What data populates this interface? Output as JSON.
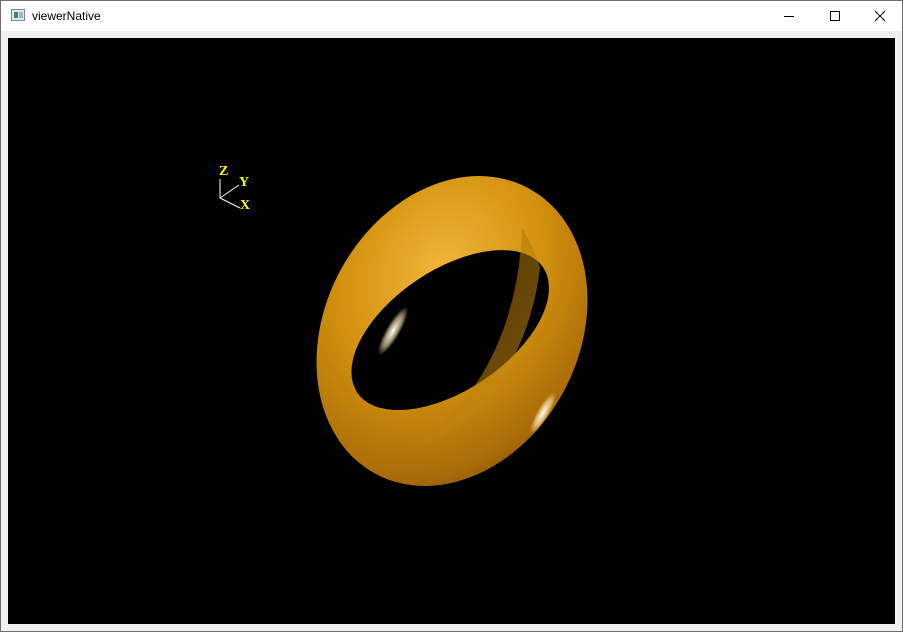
{
  "window": {
    "title": "viewerNative",
    "icon": "app-window-icon",
    "controls": {
      "minimize_icon": "minimize-icon",
      "maximize_icon": "maximize-icon",
      "close_icon": "close-icon"
    }
  },
  "viewport": {
    "background_color": "#000000",
    "axis_triad": {
      "labels": {
        "z": "Z",
        "y": "Y",
        "x": "X"
      },
      "label_color": "#ffff00",
      "line_color": "#ffffff"
    },
    "model": {
      "shape": "torus",
      "color": "#d4930f"
    }
  }
}
